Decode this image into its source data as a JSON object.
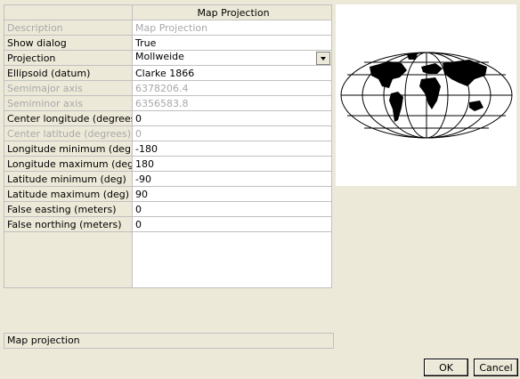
{
  "grid": {
    "header": "Map Projection",
    "rows": [
      {
        "label": "Description",
        "value": "Map Projection",
        "disabled": true
      },
      {
        "label": "Show dialog",
        "value": "True",
        "disabled": false
      },
      {
        "label": "Projection",
        "value": "Mollweide",
        "disabled": false,
        "combo": true
      },
      {
        "label": "Ellipsoid (datum)",
        "value": "Clarke 1866",
        "disabled": false
      },
      {
        "label": "Semimajor axis",
        "value": "6378206.4",
        "disabled": true
      },
      {
        "label": "Semiminor axis",
        "value": "6356583.8",
        "disabled": true
      },
      {
        "label": "Center longitude (degrees)",
        "value": "0",
        "disabled": false
      },
      {
        "label": "Center latitude (degrees)",
        "value": "0",
        "disabled": true
      },
      {
        "label": "Longitude minimum (deg)",
        "value": "-180",
        "disabled": false
      },
      {
        "label": "Longitude maximum (deg)",
        "value": "180",
        "disabled": false
      },
      {
        "label": "Latitude minimum (deg)",
        "value": "-90",
        "disabled": false
      },
      {
        "label": "Latitude maximum (deg)",
        "value": "90",
        "disabled": false
      },
      {
        "label": "False easting (meters)",
        "value": "0",
        "disabled": false
      },
      {
        "label": "False northing (meters)",
        "value": "0",
        "disabled": false
      }
    ]
  },
  "status": "Map projection",
  "buttons": {
    "ok": "OK",
    "cancel": "Cancel"
  },
  "preview": {
    "icon": "mollweide-map-icon"
  }
}
